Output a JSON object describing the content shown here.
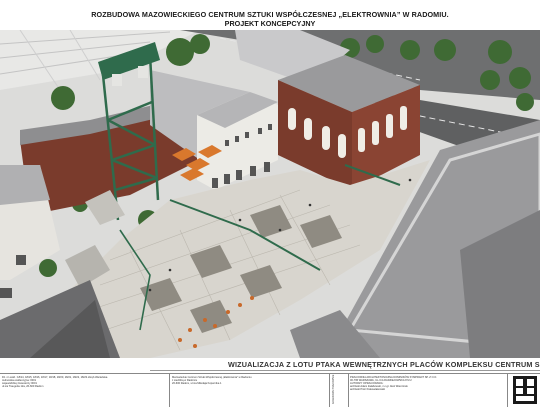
{
  "header": {
    "title_line1": "ROZBUDOWA MAZOWIECKIEGO CENTRUM SZTUKI WSPÓŁCZESNEJ „ELEKTROWNIA” W RADOMIU.",
    "title_line2": "PROJEKT KONCEPCYJNY"
  },
  "caption": "WIZUALIZACJA Z LOTU PTAKA WEWNĘTRZNYCH PLACÓW KOMPLEKSU CENTRUM SZTU",
  "title_block": {
    "col1": [
      "Dz. nr ewid.: 18/14, 18/15, 18/16, 18/17, 18/18, 18/20, 18/21, 18/22, 18/23 obręb Wariańska",
      "Jednostka ewidencyjna: 0001",
      "wojewódzkiej Inwestorzy 0001",
      "ul.ica Traugutta 12a, 26-600 Radom"
    ],
    "col2": [
      "Mazowieckie Centrum Sztuki Współczesnej „Elektrownia” w Radomiu",
      "z siedzibą w Radomiu",
      "26-600 Radom, ul.ica Mikołaja Kopernika 1"
    ],
    "col3_vertical": "ADRESOWE PRACOWNIE",
    "col4": [
      "PRACOWNIA ARCHITEKTONICZNA DOMINIKÓW SYMPRADT SP. Z O.O.",
      "00-795 WARSZAWA, UL.ICA RADZIEJOWSKA 8 M 2",
      "AUTORZY OPRACOWANIA:",
      "architekt Adam Zalabowski, m.i.gr. Aleš Wieczorek",
      "architekt Piotr Krakowiakowski"
    ]
  },
  "colors": {
    "accent_green": "#2f6b4c",
    "brick": "#7a3b2c",
    "roof_gray": "#9a9a9c",
    "plaza": "#d8d5ce"
  }
}
